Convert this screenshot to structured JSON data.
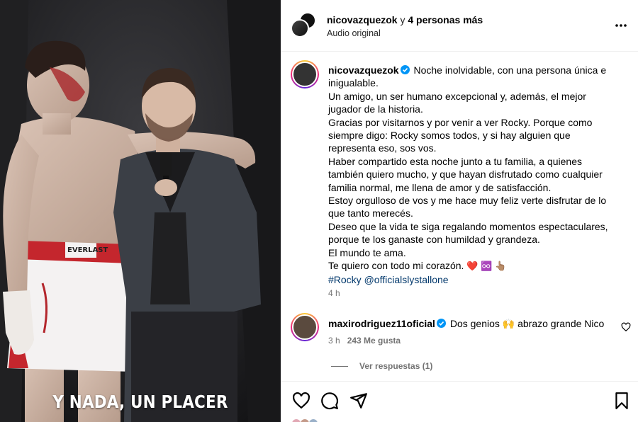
{
  "media": {
    "caption": "Y NADA, UN PLACER",
    "shorts_brand": "EVERLAST"
  },
  "header": {
    "username": "nicovazquezok",
    "connector": " y ",
    "others": "4 personas más",
    "audio": "Audio original"
  },
  "post": {
    "username": "nicovazquezok",
    "lines": [
      "Noche inolvidable, con una persona única e inigualable.",
      "Un amigo, un ser humano excepcional y, además, el mejor jugador de la historia.",
      "Gracias por visitarnos y por venir a ver Rocky. Porque como siempre digo: Rocky somos todos, y si hay alguien que representa eso, sos vos.",
      "Haber compartido esta noche junto a tu familia, a quienes también quiero mucho, y que hayan disfrutado como cualquier familia normal, me llena de amor y de satisfacción.",
      "Estoy orgulloso de vos y me hace muy feliz verte disfrutar de lo que tanto merecés.",
      "Deseo que la vida te siga regalando momentos espectaculares, porque te los ganaste con humildad y grandeza.",
      "El mundo te ama.",
      "Te quiero con todo mi corazón."
    ],
    "emojis": "❤️ ♾️ 👆🏽",
    "hashtag": "#Rocky",
    "mention": "@officialslystallone",
    "time": "4 h"
  },
  "comment": {
    "username": "maxirodriguez11oficial",
    "text_before": "Dos genios ",
    "emoji": "🙌",
    "text_after": " abrazo grande Nico",
    "time": "3 h",
    "likes": "243 Me gusta",
    "replies": "Ver respuestas (1)"
  },
  "icons": {
    "like": "heart-icon",
    "comment": "comment-icon",
    "share": "share-icon",
    "save": "bookmark-icon",
    "more": "more-icon",
    "verified": "verified-badge-icon"
  },
  "colors": {
    "verified": "#0095f6",
    "link": "#00376b",
    "muted": "#737373"
  }
}
